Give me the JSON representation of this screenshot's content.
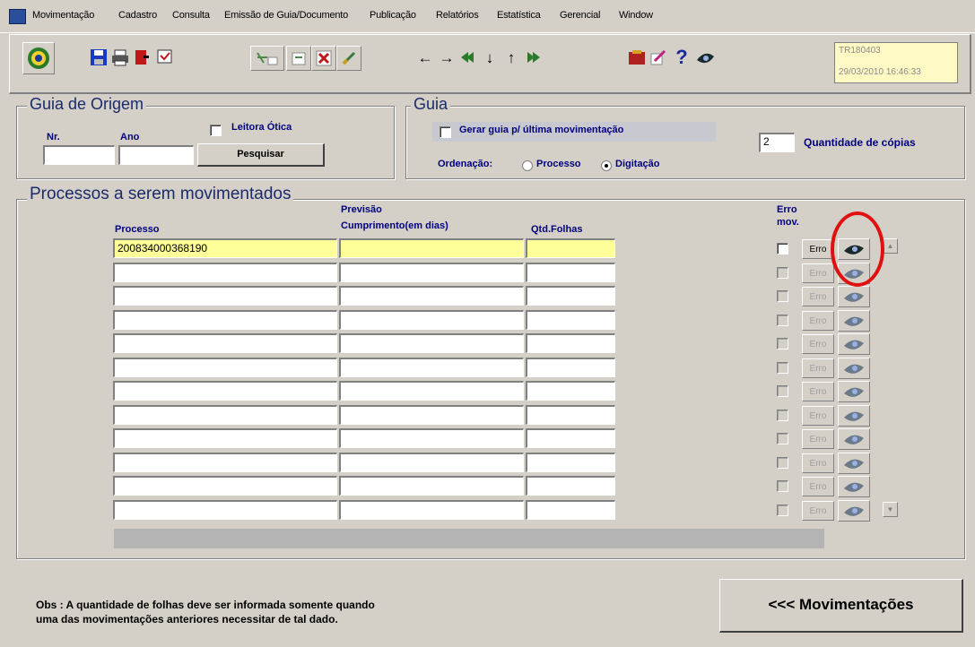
{
  "menu": [
    "Movimentação",
    "Cadastro",
    "Consulta",
    "Emissão de Guia/Documento",
    "Publicação",
    "Relatórios",
    "Estatística",
    "Gerencial",
    "Window"
  ],
  "toolbar": {
    "info_code": "TR180403",
    "info_datetime": "29/03/2010 16:46:33",
    "help_label": "?"
  },
  "guia_origem": {
    "title": "Guia de Origem",
    "leitora_label": "Leitora Ótica",
    "nr_label": "Nr.",
    "ano_label": "Ano",
    "nr_value": "",
    "ano_value": "",
    "pesquisar_label": "Pesquisar"
  },
  "guia": {
    "title": "Guia",
    "gerar_label": "Gerar guia p/ última movimentação",
    "ordenacao_label": "Ordenação:",
    "processo_label": "Processo",
    "digitacao_label": "Digitação",
    "copias_value": "2",
    "copias_label": "Quantidade de cópias"
  },
  "processos": {
    "title": "Processos a serem movimentados",
    "col_processo": "Processo",
    "col_previsao_1": "Previsão",
    "col_previsao_2": "Cumprimento(em dias)",
    "col_folhas": "Qtd.Folhas",
    "col_erro_1": "Erro",
    "col_erro_2": "mov.",
    "erro_btn_label": "Erro",
    "rows": [
      {
        "processo": "200834000368190",
        "previsao": "",
        "folhas": ""
      },
      {
        "processo": "",
        "previsao": "",
        "folhas": ""
      },
      {
        "processo": "",
        "previsao": "",
        "folhas": ""
      },
      {
        "processo": "",
        "previsao": "",
        "folhas": ""
      },
      {
        "processo": "",
        "previsao": "",
        "folhas": ""
      },
      {
        "processo": "",
        "previsao": "",
        "folhas": ""
      },
      {
        "processo": "",
        "previsao": "",
        "folhas": ""
      },
      {
        "processo": "",
        "previsao": "",
        "folhas": ""
      },
      {
        "processo": "",
        "previsao": "",
        "folhas": ""
      },
      {
        "processo": "",
        "previsao": "",
        "folhas": ""
      },
      {
        "processo": "",
        "previsao": "",
        "folhas": ""
      },
      {
        "processo": "",
        "previsao": "",
        "folhas": ""
      }
    ]
  },
  "footer": {
    "obs_line1": "Obs : A quantidade de folhas deve ser informada somente quando",
    "obs_line2": "uma das movimentações anteriores necessitar de tal dado.",
    "movimentacoes_label": "<<< Movimentações"
  },
  "colors": {
    "accent_blue": "#000080",
    "field_yellow": "#ffff99",
    "highlight_circle": "#e01010"
  }
}
